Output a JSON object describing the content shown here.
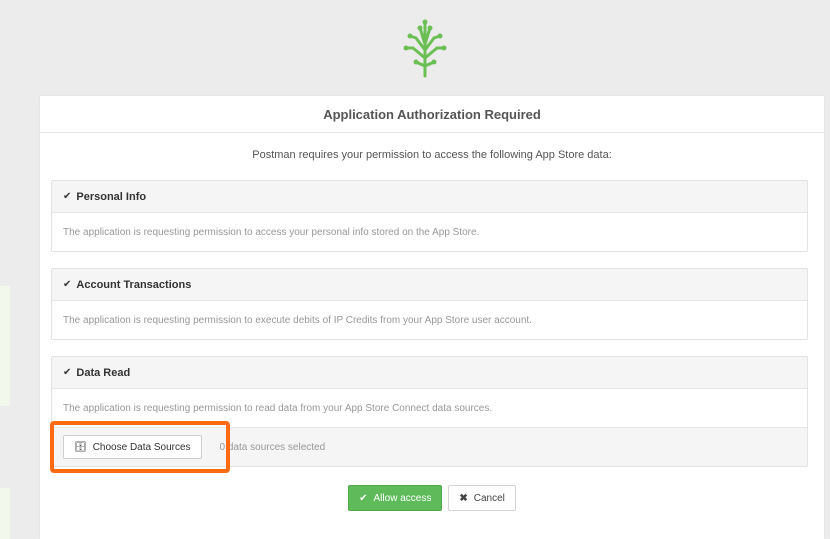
{
  "colors": {
    "accent": "#5fba5a",
    "highlight": "#ff6a13",
    "logo": "#6cbf54"
  },
  "logo": {
    "icon": "tree-logo-icon"
  },
  "dialog": {
    "title": "Application Authorization Required",
    "intro": "Postman requires your permission to access the following App Store data:"
  },
  "permissions": [
    {
      "title": "Personal Info",
      "description": "The application is requesting permission to access your personal info stored on the App Store."
    },
    {
      "title": "Account Transactions",
      "description": "The application is requesting permission to execute debits of IP Credits from your App Store user account."
    },
    {
      "title": "Data Read",
      "description": "The application is requesting permission to read data from your App Store Connect data sources.",
      "choose_label": "Choose Data Sources",
      "selected_text": "0 data sources selected"
    }
  ],
  "actions": {
    "allow_label": "Allow access",
    "cancel_label": "Cancel"
  },
  "icons": {
    "check": "✔",
    "database": "🗄",
    "close": "✖"
  }
}
